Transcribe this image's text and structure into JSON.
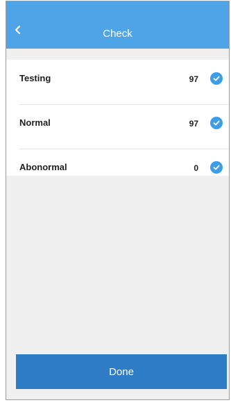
{
  "header": {
    "title": "Check",
    "back_icon": "chevron-left-icon"
  },
  "results": [
    {
      "label": "Testing",
      "value": "97",
      "icon": "check-circle-icon"
    },
    {
      "label": "Normal",
      "value": "97",
      "icon": "check-circle-icon"
    },
    {
      "label": "Abonormal",
      "value": "0",
      "icon": "check-circle-icon"
    }
  ],
  "footer": {
    "done_label": "Done"
  },
  "colors": {
    "header_bg": "#4ea4e6",
    "check": "#3d9ee7",
    "done_bg": "#2f7cc6",
    "page_bg": "#f0f0f0"
  }
}
